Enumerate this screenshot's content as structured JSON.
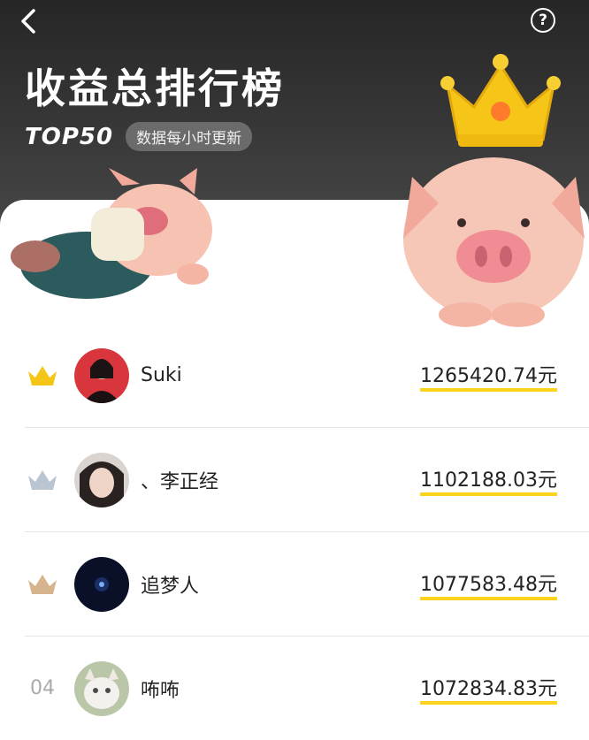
{
  "header": {
    "title": "收益总排行榜",
    "top_label": "TOP50",
    "update_badge": "数据每小时更新"
  },
  "icons": {
    "back": "chevron-left-icon",
    "help": "question-circle-icon",
    "help_glyph": "?"
  },
  "colors": {
    "header_bg": "#2e2e2e",
    "gold": "#f5c518",
    "silver": "#b9c6d2",
    "bronze": "#d7b48d",
    "amount_underline": "#ffd21e"
  },
  "ranking": [
    {
      "rank": "1",
      "name": "Suki",
      "amount": "1265420.74元"
    },
    {
      "rank": "2",
      "name": "、李正经",
      "amount": "1102188.03元"
    },
    {
      "rank": "3",
      "name": "追梦人",
      "amount": "1077583.48元"
    },
    {
      "rank": "04",
      "name": "咘咘",
      "amount": "1072834.83元"
    }
  ]
}
